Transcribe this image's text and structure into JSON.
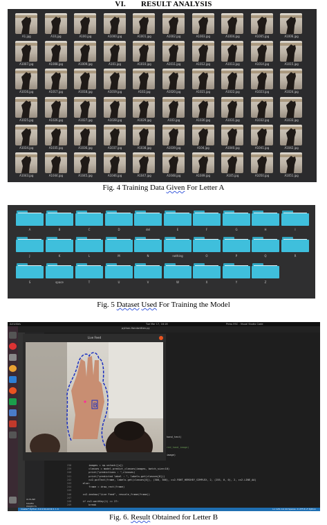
{
  "section_heading": {
    "number": "VI.",
    "title": "RESULT ANALYSIS"
  },
  "fig4": {
    "caption": [
      "Fig. 4 Training Data ",
      "Given",
      " For Letter  A"
    ],
    "thumbnails": [
      "A1.jpg",
      "A10.jpg",
      "A100.jpg",
      "A1000.jpg",
      "A1001.jpg",
      "A1002.jpg",
      "A1003.jpg",
      "A1004.jpg",
      "A1005.jpg",
      "A1006.jpg",
      "A1007.jpg",
      "A1008.jpg",
      "A1009.jpg",
      "A101.jpg",
      "A1010.jpg",
      "A1011.jpg",
      "A1012.jpg",
      "A1013.jpg",
      "A1014.jpg",
      "A1015.jpg",
      "A1016.jpg",
      "A1017.jpg",
      "A1018.jpg",
      "A1019.jpg",
      "A102.jpg",
      "A1020.jpg",
      "A1021.jpg",
      "A1022.jpg",
      "A1023.jpg",
      "A1024.jpg",
      "A1025.jpg",
      "A1026.jpg",
      "A1027.jpg",
      "A1028.jpg",
      "A1029.jpg",
      "A103.jpg",
      "A1030.jpg",
      "A1031.jpg",
      "A1032.jpg",
      "A1033.jpg",
      "A1034.jpg",
      "A1035.jpg",
      "A1036.jpg",
      "A1037.jpg",
      "A1038.jpg",
      "A1039.jpg",
      "A104.jpg",
      "A1040.jpg",
      "A1041.jpg",
      "A1042.jpg",
      "A1043.jpg",
      "A1044.jpg",
      "A1045.jpg",
      "A1046.jpg",
      "A1047.jpg",
      "A1048.jpg",
      "A1049.jpg",
      "A105.jpg",
      "A1050.jpg",
      "A1051.jpg"
    ]
  },
  "fig5": {
    "caption": [
      "Fig. 5 ",
      "Dataset",
      " ",
      "Used",
      " For Training  the Model"
    ],
    "folders": [
      "A",
      "B",
      "C",
      "D",
      "del",
      "E",
      "F",
      "G",
      "H",
      "I",
      "J",
      "K",
      "L",
      "M",
      "N",
      "nothing",
      "O",
      "P",
      "Q",
      "R",
      "S",
      "space",
      "T",
      "U",
      "V",
      "W",
      "X",
      "Y",
      "Z"
    ]
  },
  "fig6": {
    "caption": [
      "Fig. 6. ",
      "Result",
      " Obtained for Letter B"
    ],
    "topbar": {
      "activities": "Activities",
      "clock": "Tue Mar 17, 18:18",
      "app_title": "Press ESC - Visual Studio Code"
    },
    "live_window_title": "Live Feed",
    "editor_tab": "python-Handwritten.py",
    "status_left": "master*   Python 3.6.9 64-bit   ⊗ 0 ⚠ 0",
    "status_right": "Ln 128, Col 44   Spaces: 4   UTF-8   LF   Python",
    "sidebar_sections": [
      "OUTLINE",
      "MAVEN PROJECTS"
    ],
    "line_numbers": [
      "238",
      "239",
      "240",
      "241",
      "242",
      "243",
      "244",
      "245",
      "246",
      "247",
      "248",
      "249"
    ],
    "code_lines": [
      "        images = np.vstack([x])",
      "        classes = model.predict_classes(images, batch_size=10)",
      "        print(\"predictions : \",classes)",
      "        print(\"predicted label : \", labels.get(classes[0]))",
      "        cv2.putText(frame, labels.get(classes[0]), (300, 300), cv2.FONT_HERSHEY_SIMPLEX, 2, (255, 0, 0), 2, cv2.LINE_AA)",
      "    else:",
      "        frame = draw_rect(frame)",
      "",
      "    cv2.imshow(\"Live Feed\", rescale_frame(frame))",
      "",
      "    if cv2.waitKey(1) == 27:",
      "        break"
    ],
    "partial_code_right": [
      "hand_test)",
      "red_hand_image)",
      "image)"
    ],
    "colors": {
      "accent": "#1f6fb2",
      "editor_bg": "#1e1e1e",
      "folder": "#3fbfdc",
      "contour": "#1a2fbf"
    }
  }
}
